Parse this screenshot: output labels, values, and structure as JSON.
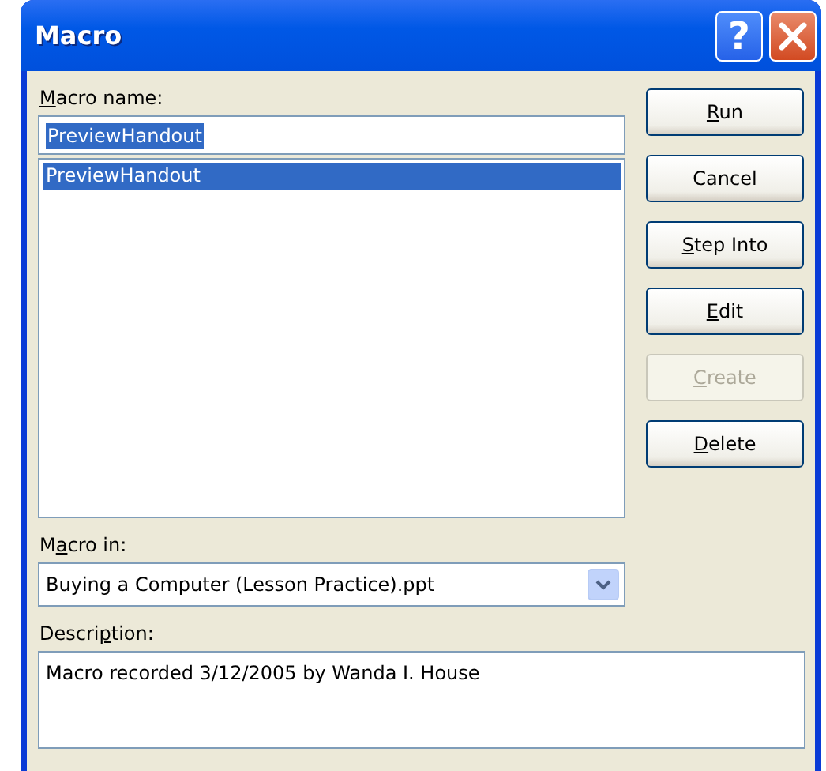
{
  "window": {
    "title": "Macro"
  },
  "title_buttons": [
    {
      "kind": "help",
      "label": "?"
    },
    {
      "kind": "close"
    }
  ],
  "macro_name": {
    "label": [
      {
        "text": "M",
        "underlined": true
      },
      {
        "text": "acro name:",
        "underlined": false
      }
    ],
    "value": "PreviewHandout",
    "value_selected": true
  },
  "macro_list": [
    {
      "label": "PreviewHandout",
      "selected": true
    }
  ],
  "macro_in": {
    "label": [
      {
        "text": "M",
        "underlined": false
      },
      {
        "text": "a",
        "underlined": true
      },
      {
        "text": "cro in:",
        "underlined": false
      }
    ],
    "value": "Buying a Computer (Lesson Practice).ppt"
  },
  "description": {
    "label": [
      {
        "text": "Descri",
        "underlined": false
      },
      {
        "text": "p",
        "underlined": true
      },
      {
        "text": "tion:",
        "underlined": false
      }
    ],
    "value": "Macro recorded 3/12/2005 by Wanda I. House"
  },
  "buttons": [
    {
      "label": [
        {
          "text": "R",
          "underlined": true
        },
        {
          "text": "un",
          "underlined": false
        }
      ],
      "disabled": false
    },
    {
      "label": [
        {
          "text": "Cancel",
          "underlined": false
        }
      ],
      "disabled": false
    },
    {
      "label": [
        {
          "text": "S",
          "underlined": true
        },
        {
          "text": "tep Into",
          "underlined": false
        }
      ],
      "disabled": false
    },
    {
      "label": [
        {
          "text": "E",
          "underlined": true
        },
        {
          "text": "dit",
          "underlined": false
        }
      ],
      "disabled": false
    },
    {
      "label": [
        {
          "text": "C",
          "underlined": true
        },
        {
          "text": "reate",
          "underlined": false
        }
      ],
      "disabled": true
    },
    {
      "label": [
        {
          "text": "D",
          "underlined": true
        },
        {
          "text": "elete",
          "underlined": false
        }
      ],
      "disabled": false
    }
  ]
}
